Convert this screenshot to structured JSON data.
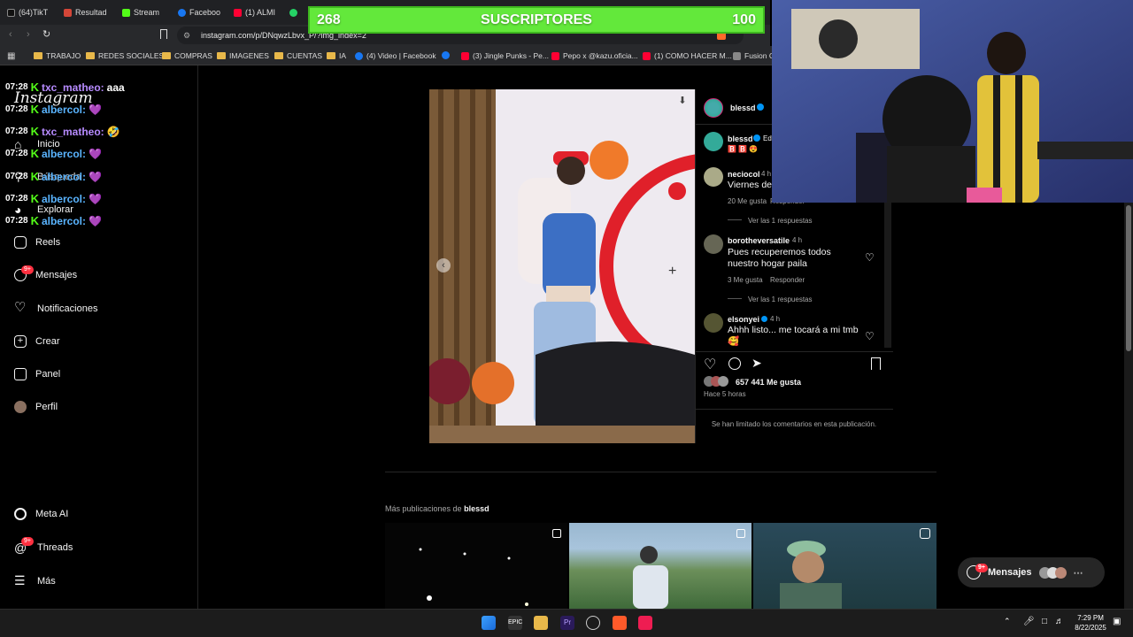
{
  "browser": {
    "tabs": [
      {
        "label": "(64)TikT",
        "color": "#000000"
      },
      {
        "label": "Resultad",
        "color": "#d44638"
      },
      {
        "label": "Stream",
        "color": "#53fc18"
      },
      {
        "label": "Faceboo",
        "color": "#1877f2"
      },
      {
        "label": "(1) ALMI",
        "color": "#ff0033"
      },
      {
        "label": "",
        "color": "#25d366"
      }
    ],
    "url": "instagram.com/p/DNqwzLbvx_P/?img_index=2",
    "bookmarks": [
      "TRABAJO",
      "REDES SOCIALES",
      "COMPRAS",
      "IMAGENES",
      "CUENTAS",
      "IA",
      "(4) Video | Facebook",
      "(3) Jingle Punks - Pe...",
      "Pepo x @kazu.oficia...",
      "(1) COMO HACER M...",
      "Fusion Cl"
    ]
  },
  "subscribers": {
    "current": "268",
    "label": "SUSCRIPTORES",
    "goal": "100"
  },
  "chat": [
    {
      "time": "07:28",
      "user": "txc_matheo:",
      "msg": "aaa",
      "ucolor": "u1"
    },
    {
      "time": "07:28",
      "user": "albercol:",
      "msg": "💜",
      "ucolor": "u2"
    },
    {
      "time": "07:28",
      "user": "txc_matheo:",
      "msg": "🤣",
      "ucolor": "u1"
    },
    {
      "time": "07:28",
      "user": "albercol:",
      "msg": "💜",
      "ucolor": "u2"
    },
    {
      "time": "07:28",
      "user": "albercol:",
      "msg": "💜",
      "ucolor": "u2"
    },
    {
      "time": "07:28",
      "user": "albercol:",
      "msg": "💜",
      "ucolor": "u2"
    },
    {
      "time": "07:28",
      "user": "albercol:",
      "msg": "💜",
      "ucolor": "u2"
    }
  ],
  "instagram": {
    "logo": "Instagram",
    "nav": {
      "inicio": "Inicio",
      "busqueda": "Búsqueda",
      "explorar": "Explorar",
      "reels": "Reels",
      "mensajes": "Mensajes",
      "notificaciones": "Notificaciones",
      "crear": "Crear",
      "panel": "Panel",
      "perfil": "Perfil",
      "metaai": "Meta AI",
      "threads": "Threads",
      "mas": "Más",
      "badge": "9+"
    },
    "post": {
      "author": "blessd",
      "caption_user": "blessd",
      "caption_text": "Ed",
      "caption_emoji": "🅱️ 🅱️ 😍",
      "comments": [
        {
          "user": "neciocol",
          "time": "4 h",
          "text": "Viernes de",
          "likes": "20 Me gusta",
          "reply": "Responder",
          "replies": "Ver las 1 respuestas"
        },
        {
          "user": "borotheversatile",
          "time": "4 h",
          "text": "Pues recuperemos todos nuestro hogar paila",
          "likes": "3 Me gusta",
          "reply": "Responder",
          "replies": "Ver las 1 respuestas"
        },
        {
          "user": "elsonyei",
          "time": "4 h",
          "text": "Ahhh listo... me tocará a mi tmb 🥰",
          "likes": "",
          "reply": "",
          "replies": ""
        }
      ],
      "likes": "657 441 Me gusta",
      "posted": "Hace 5 horas",
      "limited": "Se han limitado los comentarios en esta publicación."
    },
    "more_prefix": "Más publicaciones de",
    "more_user": "blessd",
    "messages_pill": "Mensajes",
    "messages_badge": "9+"
  },
  "taskbar": {
    "time": "7:29 PM",
    "date": "8/22/2025"
  }
}
